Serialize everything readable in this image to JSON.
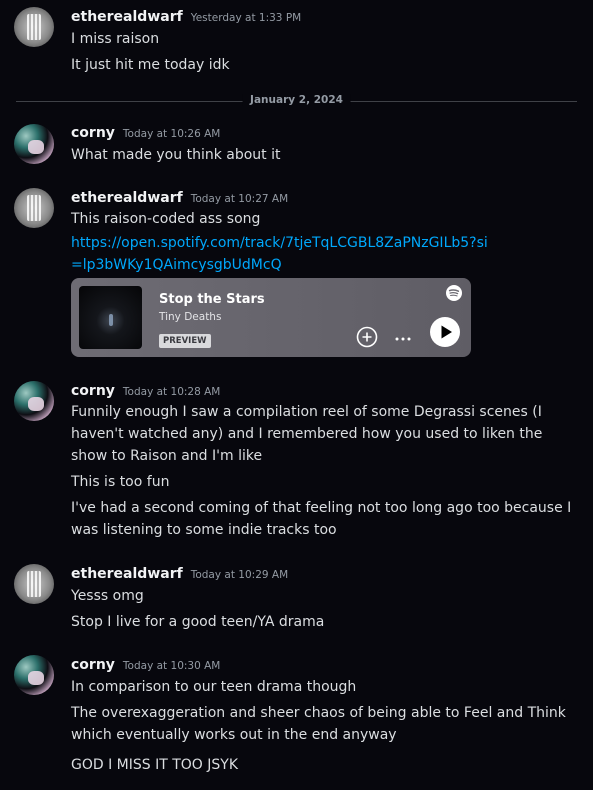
{
  "date_divider": "January 2, 2024",
  "messages": [
    {
      "username": "etherealdwarf",
      "timestamp": "Yesterday at 1:33 PM",
      "lines": [
        "I miss raison",
        "It just hit me today idk"
      ]
    },
    {
      "username": "corny",
      "timestamp": "Today at 10:26 AM",
      "lines": [
        "What made you think about it"
      ]
    },
    {
      "username": "etherealdwarf",
      "timestamp": "Today at 10:27 AM",
      "lines": [
        "This raison-coded ass song"
      ],
      "link": "https://open.spotify.com/track/7tjeTqLCGBL8ZaPNzGILb5?si=lp3bWKy1QAimcysgbUdMcQ",
      "embed": {
        "title": "Stop the Stars",
        "artist": "Tiny Deaths",
        "badge": "PREVIEW",
        "service_icon": "spotify-icon",
        "buttons": [
          "add-icon",
          "more-icon",
          "play-icon"
        ]
      }
    },
    {
      "username": "corny",
      "timestamp": "Today at 10:28 AM",
      "lines": [
        "Funnily enough I saw a compilation reel of some Degrassi scenes (I haven't watched any) and I remembered how you used to liken the show to Raison and I'm like",
        "This is too fun",
        "I've had a second coming of that feeling not too long ago too because I was listening to some indie tracks too"
      ]
    },
    {
      "username": "etherealdwarf",
      "timestamp": "Today at 10:29 AM",
      "lines": [
        "Yesss omg",
        "Stop I live for a good teen/YA drama"
      ]
    },
    {
      "username": "corny",
      "timestamp": "Today at 10:30 AM",
      "lines": [
        "In comparison to our teen drama though",
        "The overexaggeration and sheer chaos of being able to Feel and Think which eventually works out in the end anyway",
        "GOD I MISS IT TOO JSYK"
      ]
    }
  ],
  "colors": {
    "background": "#07070d",
    "username": "#f2f3f5",
    "text": "#dbdee1",
    "timestamp": "#949ba4",
    "link": "#00a8fc",
    "embed_bg": "#6e6c74"
  }
}
